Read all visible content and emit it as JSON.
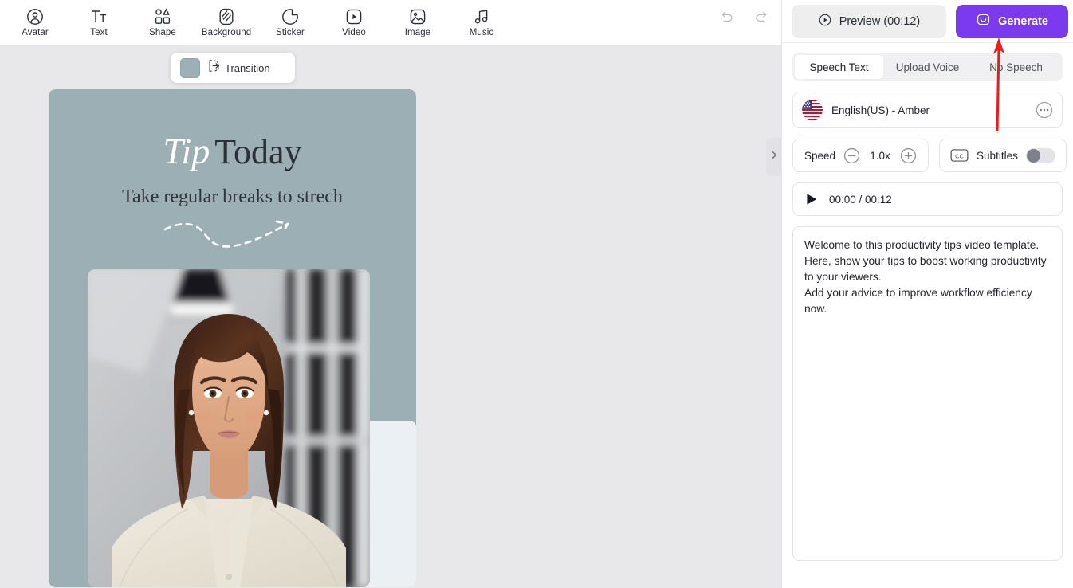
{
  "toolbar": {
    "tools": [
      {
        "label": "Avatar",
        "icon": "avatar-icon"
      },
      {
        "label": "Text",
        "icon": "text-icon"
      },
      {
        "label": "Shape",
        "icon": "shape-icon"
      },
      {
        "label": "Background",
        "icon": "background-icon"
      },
      {
        "label": "Sticker",
        "icon": "sticker-icon"
      },
      {
        "label": "Video",
        "icon": "video-icon"
      },
      {
        "label": "Image",
        "icon": "image-icon"
      },
      {
        "label": "Music",
        "icon": "music-icon"
      }
    ],
    "undo": "undo-icon",
    "redo": "redo-icon"
  },
  "canvas": {
    "transition": {
      "label": "Transition",
      "swatch_color": "#9db0b6"
    },
    "slide": {
      "background_color": "#9bafb5",
      "title_italic": "Tip",
      "title_rest": "Today",
      "subtitle": "Take regular breaks to strech"
    },
    "collapse_handle": "chevron-right-icon"
  },
  "panel": {
    "preview_label": "Preview (00:12)",
    "generate_label": "Generate",
    "generate_color": "#7c3aee",
    "tabs": [
      {
        "label": "Speech Text",
        "active": true
      },
      {
        "label": "Upload Voice",
        "active": false
      },
      {
        "label": "No Speech",
        "active": false
      }
    ],
    "voice": {
      "name": "English(US) - Amber",
      "flag": "us-flag-icon",
      "more": "more-options-icon"
    },
    "speed": {
      "label": "Speed",
      "value": "1.0x",
      "decrease": "minus-icon",
      "increase": "plus-icon"
    },
    "subtitles": {
      "label": "Subtitles",
      "icon": "cc-icon",
      "state": "off"
    },
    "player": {
      "play": "play-icon",
      "time": "00:00 / 00:12"
    },
    "script": "Welcome to this productivity tips video template.\nHere, show your tips to boost working productivity to your viewers.\nAdd your advice to improve workflow efficiency now."
  },
  "annotation": {
    "arrow_color": "#ee1b1b",
    "points_at": "generate-button"
  }
}
